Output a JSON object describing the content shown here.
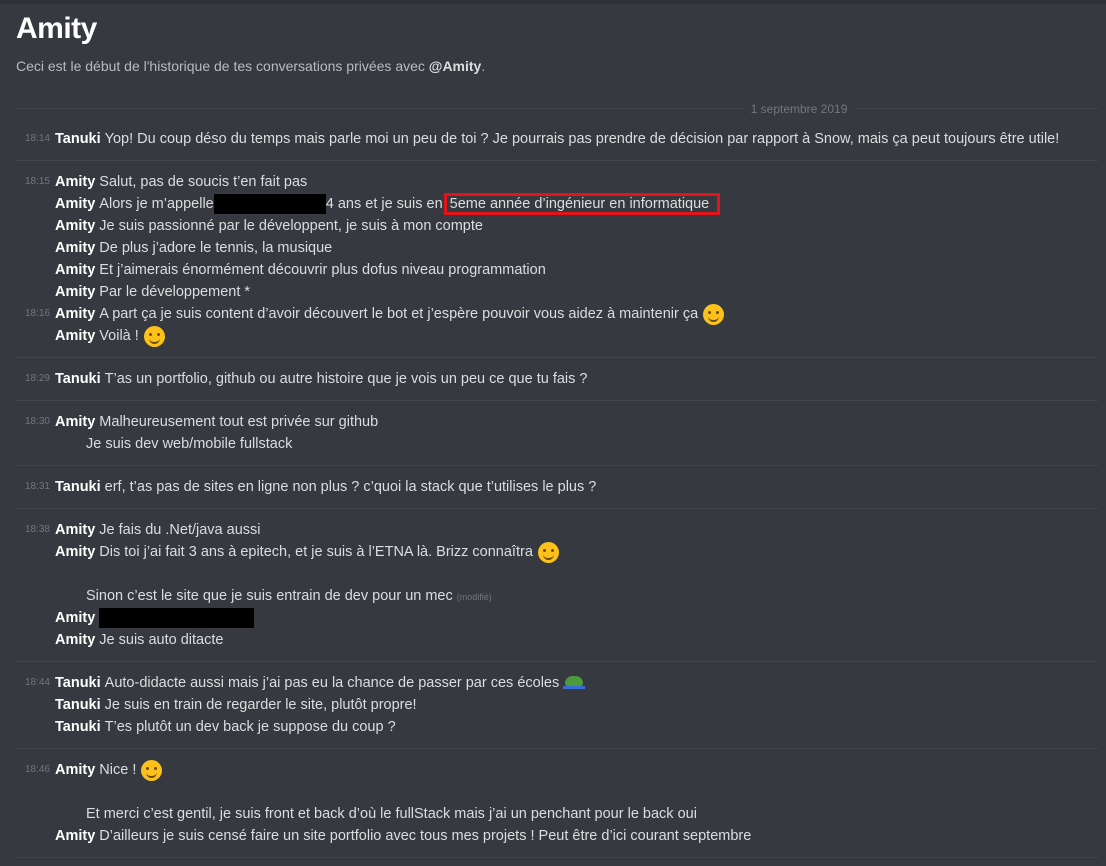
{
  "header": {
    "title": "Amity",
    "subtitle_pre": "Ceci est le début de l'historique de tes conversations privées avec ",
    "subtitle_mention": "@Amity",
    "subtitle_post": "."
  },
  "date_divider": "1 septembre 2019",
  "edited_label": "(modifié)",
  "groups": [
    {
      "lines": [
        {
          "time": "18:14",
          "author": "Tanuki",
          "text": "Yop! Du coup déso du temps mais parle moi un peu de toi ? Je pourrais pas prendre de décision par rapport à Snow, mais ça peut toujours être utile!"
        }
      ]
    },
    {
      "lines": [
        {
          "time": "18:15",
          "author": "Amity",
          "text": "Salut, pas de soucis t’en fait pas"
        },
        {
          "author": "Amity",
          "text": "Alors je m’appelle",
          "redacted": true,
          "post": "4 ans et je suis en ",
          "highlight": "5eme année d’ingénieur en informatique"
        },
        {
          "author": "Amity",
          "text": "Je suis passionné par le développent, je suis à mon compte"
        },
        {
          "author": "Amity",
          "text": "De plus j’adore le tennis, la musique"
        },
        {
          "author": "Amity",
          "text": "Et j’aimerais énormément découvrir plus dofus niveau programmation"
        },
        {
          "author": "Amity",
          "text": "Par le développement *"
        },
        {
          "time": "18:16",
          "author": "Amity",
          "text": "A part ça je suis content d’avoir découvert le bot et j’espère pouvoir vous aidez à maintenir ça",
          "emoji": "wink-emoji"
        },
        {
          "author": "Amity",
          "text": "Voilà !",
          "emoji": "grin-emoji"
        }
      ]
    },
    {
      "lines": [
        {
          "time": "18:29",
          "author": "Tanuki",
          "text": "T’as un portfolio, github ou autre histoire que je vois un peu ce que tu fais ?"
        }
      ]
    },
    {
      "lines": [
        {
          "time": "18:30",
          "author": "Amity",
          "text": "Malheureusement tout est privée sur github"
        },
        {
          "text": "Je suis dev web/mobile fullstack"
        }
      ]
    },
    {
      "lines": [
        {
          "time": "18:31",
          "author": "Tanuki",
          "text": "erf, t’as pas de sites en ligne non plus ? c’quoi la stack que t’utilises le plus ?"
        }
      ]
    },
    {
      "lines": [
        {
          "time": "18:38",
          "author": "Amity",
          "text": "Je fais du .Net/java aussi"
        },
        {
          "author": "Amity",
          "text": "Dis toi j’ai fait 3 ans à epitech, et je suis à l’ETNA là. Brizz connaîtra",
          "emoji": "wink-emoji"
        },
        {
          "text": ""
        },
        {
          "text": "Sinon c’est le site que je suis entrain de dev pour un mec",
          "edited": true
        },
        {
          "author": "Amity",
          "text": "",
          "redacted": true
        },
        {
          "author": "Amity",
          "text": "Je suis auto ditacte"
        }
      ]
    },
    {
      "lines": [
        {
          "time": "18:44",
          "author": "Tanuki",
          "text": "Auto-didacte aussi mais j’ai pas eu la chance de passer par ces écoles",
          "emoji": "frog-emoji"
        },
        {
          "author": "Tanuki",
          "text": "Je suis en train de regarder le site, plutôt propre!"
        },
        {
          "author": "Tanuki",
          "text": "T’es plutôt un dev back je suppose du coup ?"
        }
      ]
    },
    {
      "lines": [
        {
          "time": "18:46",
          "author": "Amity",
          "text": "Nice !",
          "emoji": "smile-emoji"
        },
        {
          "text": ""
        },
        {
          "text": "Et merci c’est gentil, je suis front et back d’où le fullStack mais j’ai un penchant pour le back oui"
        },
        {
          "author": "Amity",
          "text": "D’ailleurs je suis censé faire un site portfolio avec tous mes projets ! Peut être d’ici courant septembre"
        }
      ]
    }
  ]
}
